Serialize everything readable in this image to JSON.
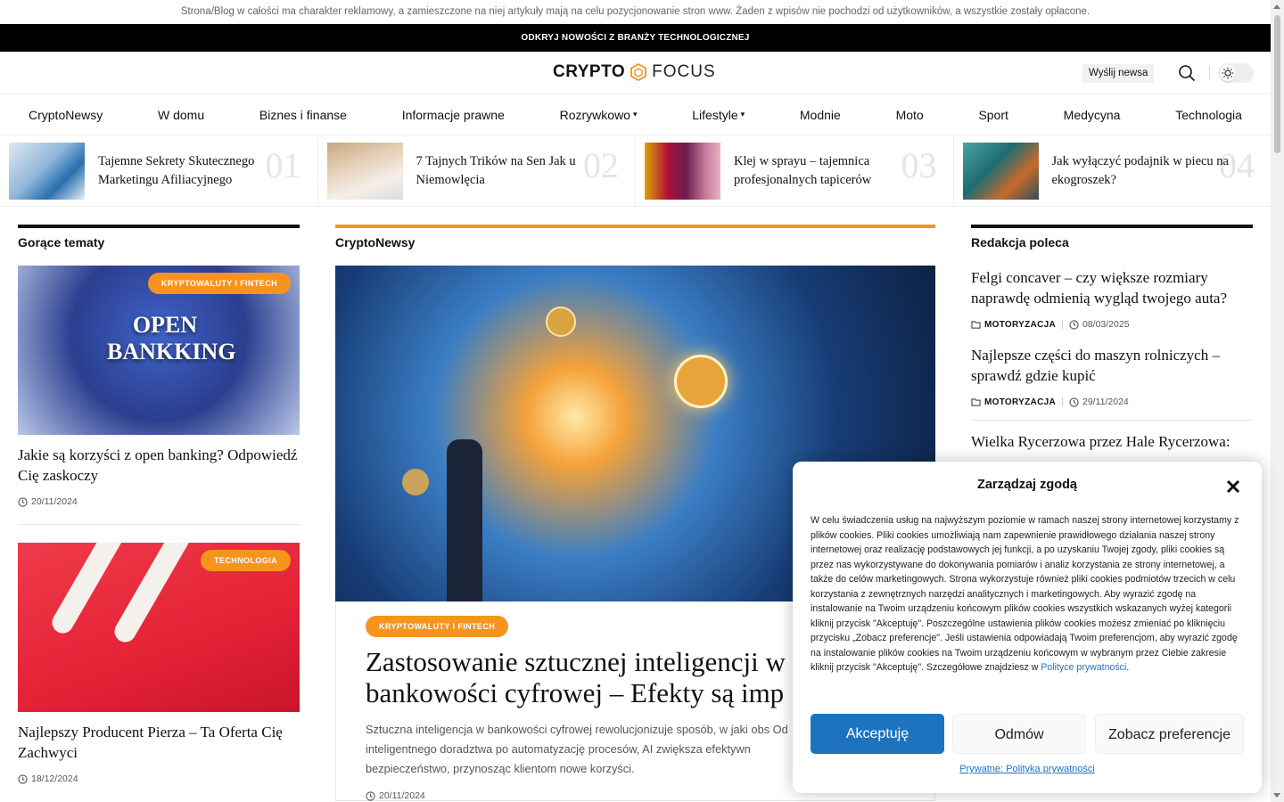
{
  "disclaimer": "Strona/Blog w całości ma charakter reklamowy, a zamieszczone na niej artykuły mają na celu pozycjonowanie stron www. Żaden z wpisów nie pochodzi od użytkowników, a wszystkie zostały opłacone.",
  "topbar": "ODKRYJ NOWOŚCI Z BRANŻY TECHNOLOGICZNEJ",
  "header": {
    "logo_bold": "CRYPTO",
    "logo_light": "FOCUS",
    "send_news": "Wyślij newsa"
  },
  "nav": [
    {
      "label": "CryptoNewsy"
    },
    {
      "label": "W domu"
    },
    {
      "label": "Biznes i finanse"
    },
    {
      "label": "Informacje prawne"
    },
    {
      "label": "Rozrywkowo",
      "chevron": "⌄"
    },
    {
      "label": "Lifestyle",
      "chevron": "⌄"
    },
    {
      "label": "Modnie"
    },
    {
      "label": "Moto"
    },
    {
      "label": "Sport"
    },
    {
      "label": "Medycyna"
    },
    {
      "label": "Technologia"
    }
  ],
  "trending": [
    {
      "title": "Tajemne Sekrety Skutecznego Marketingu Afiliacyjnego",
      "num": "01"
    },
    {
      "title": "7 Tajnych Trików na Sen Jak u Niemowlęcia",
      "num": "02"
    },
    {
      "title": "Klej w sprayu – tajemnica profesjonalnych tapicerów",
      "num": "03"
    },
    {
      "title": "Jak wyłączyć podajnik w piecu na ekogroszek?",
      "num": "04"
    }
  ],
  "hot": {
    "title": "Gorące tematy",
    "items": [
      {
        "badge": "KRYPTOWALUTY I FINTECH",
        "title": "Jakie są korzyści z open banking? Odpowiedź Cię zaskoczy",
        "date": "20/11/2024",
        "img_text": "OPEN BANKKING"
      },
      {
        "badge": "TECHNOLOGIA",
        "title": "Najlepszy Producent Pierza – Ta Oferta Cię Zachwyci",
        "date": "18/12/2024"
      }
    ]
  },
  "crypto": {
    "title": "CryptoNewsy",
    "badge": "KRYPTOWALUTY I FINTECH",
    "headline": "Zastosowanie sztucznej inteligencji w bankowości cyfrowej – Efekty są imp",
    "excerpt": "Sztuczna inteligencja w bankowości cyfrowej rewolucjonizuje sposób, w jaki obs Od inteligentnego doradztwa po automatyzację procesów, AI zwiększa efektywn bezpieczeństwo, przynosząc klientom nowe korzyści.",
    "date": "20/11/2024"
  },
  "editors": {
    "title": "Redakcja poleca",
    "items": [
      {
        "title": "Felgi concaver – czy większe rozmiary naprawdę odmienią wygląd twojego auta?",
        "cat": "MOTORYZACJA",
        "date": "08/03/2025"
      },
      {
        "title": "Najlepsze części do maszyn rolniczych – sprawdź gdzie kupić",
        "cat": "MOTORYZACJA",
        "date": "29/11/2024"
      },
      {
        "title": "Wielka Rycerzowa przez Hale Rycerzowa:"
      }
    ]
  },
  "consent": {
    "title": "Zarządzaj zgodą",
    "text": "W celu świadczenia usług na najwyższym poziomie w ramach naszej strony internetowej korzystamy z plików cookies. Pliki cookies umożliwiają nam zapewnienie prawidłowego działania naszej strony internetowej oraz realizację podstawowych jej funkcji, a po uzyskaniu Twojej zgody, pliki cookies są przez nas wykorzystywane do dokonywania pomiarów i analiz korzystania ze strony internetowej, a także do celów marketingowych. Strona wykorzystuje również pliki cookies podmiotów trzecich w celu korzystania z zewnętrznych narzędzi analitycznych i marketingowych. Aby wyrazić zgodę na instalowanie na Twoim urządzeniu końcowym plików cookies wszystkich wskazanych wyżej kategorii kliknij przycisk \"Akceptuję\". Poszczególne ustawienia plików cookies możesz zmieniać po kliknięciu przycisku „Zobacz preferencje\". Jeśli ustawienia odpowiadają Twoim preferencjom, aby wyrazić zgodę na instalowanie plików cookies na Twoim urządzeniu końcowym w wybranym przez Ciebie zakresie kliknij przycisk \"Akceptuję\". Szczegółowe znajdziesz w",
    "link": "Polityce prywatności",
    "accept": "Akceptuję",
    "deny": "Odmów",
    "prefs": "Zobacz preferencje",
    "privacy": "Prywatne: Polityka prywatności"
  },
  "colors": {
    "accent": "#f7941d",
    "primary": "#1e73be"
  }
}
